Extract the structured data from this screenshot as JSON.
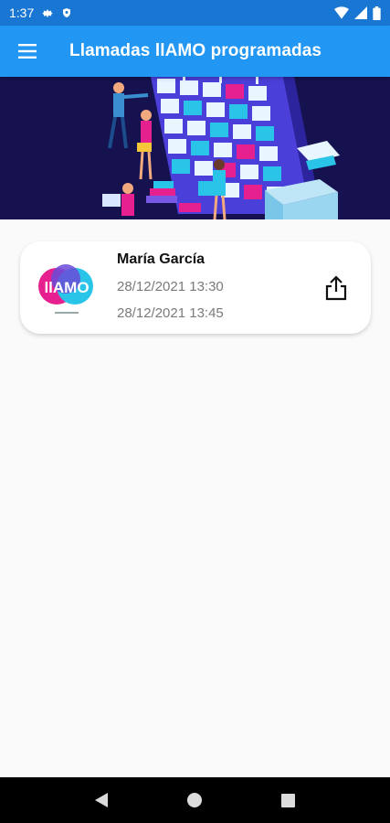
{
  "status_bar": {
    "time": "1:37",
    "icons": [
      "gear-icon",
      "shield-icon",
      "wifi-icon",
      "signal-icon",
      "battery-icon"
    ]
  },
  "app_bar": {
    "menu_icon": "hamburger-menu-icon",
    "title": "Llamadas llAMO programadas"
  },
  "colors": {
    "status_bar": "#1976d2",
    "app_bar": "#2196f3",
    "banner_bg": "#15124f",
    "card_bg": "#ffffff",
    "date_text": "#7a7a7a"
  },
  "calls": [
    {
      "logo_text": "llAMO",
      "name": "María García",
      "start": "28/12/2021 13:30",
      "end": "28/12/2021 13:45",
      "action_icon": "share-icon"
    }
  ],
  "nav_bar": {
    "icons": [
      "back-icon",
      "home-icon",
      "recents-icon"
    ]
  }
}
